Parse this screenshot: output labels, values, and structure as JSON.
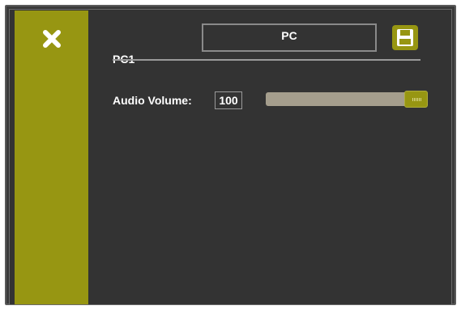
{
  "header": {
    "source_name": "PC1",
    "name_value": "PC"
  },
  "audio": {
    "label": "Audio Volume:",
    "value": "100",
    "level_fraction": 1.0
  },
  "colors": {
    "accent": "#979612",
    "background": "#333333",
    "slider_track": "#a59e8d"
  },
  "icons": {
    "close": "close-icon",
    "save": "save-icon"
  }
}
